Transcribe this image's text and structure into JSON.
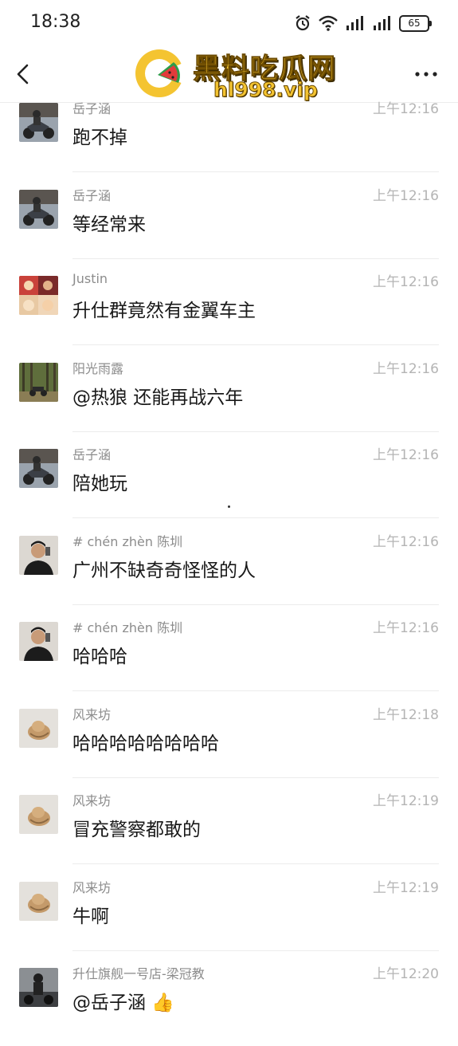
{
  "status_bar": {
    "time": "18:38",
    "battery": "65"
  },
  "nav": {
    "logo_title": "黑料吃瓜网",
    "logo_url": "hl998.vip"
  },
  "messages": [
    {
      "sender": "岳子涵",
      "time": "上午12:16",
      "text": "跑不掉",
      "avatar": "motorcycle-photo"
    },
    {
      "sender": "岳子涵",
      "time": "上午12:16",
      "text": "等经常来",
      "avatar": "motorcycle-photo"
    },
    {
      "sender": "Justin",
      "time": "上午12:16",
      "text": "升仕群竟然有金翼车主",
      "avatar": "anime-collage"
    },
    {
      "sender": "阳光雨露",
      "time": "上午12:16",
      "text": "@热狼 还能再战六年",
      "avatar": "forest-motorcycle"
    },
    {
      "sender": "岳子涵",
      "time": "上午12:16",
      "text": "陪她玩",
      "avatar": "motorcycle-photo"
    },
    {
      "sender": "# chén zhèn   陈圳",
      "time": "上午12:16",
      "text": "广州不缺奇奇怪怪的人",
      "avatar": "man-selfie"
    },
    {
      "sender": "# chén zhèn   陈圳",
      "time": "上午12:16",
      "text": "哈哈哈",
      "avatar": "man-selfie"
    },
    {
      "sender": "风来坊",
      "time": "上午12:18",
      "text": "哈哈哈哈哈哈哈哈",
      "avatar": "hat-photo"
    },
    {
      "sender": "风来坊",
      "time": "上午12:19",
      "text": "冒充警察都敢的",
      "avatar": "hat-photo"
    },
    {
      "sender": "风来坊",
      "time": "上午12:19",
      "text": "牛啊",
      "avatar": "hat-photo"
    },
    {
      "sender": "升仕旗舰一号店-梁冠教",
      "time": "上午12:20",
      "text": "@岳子涵 👍",
      "avatar": "rider-photo"
    }
  ]
}
